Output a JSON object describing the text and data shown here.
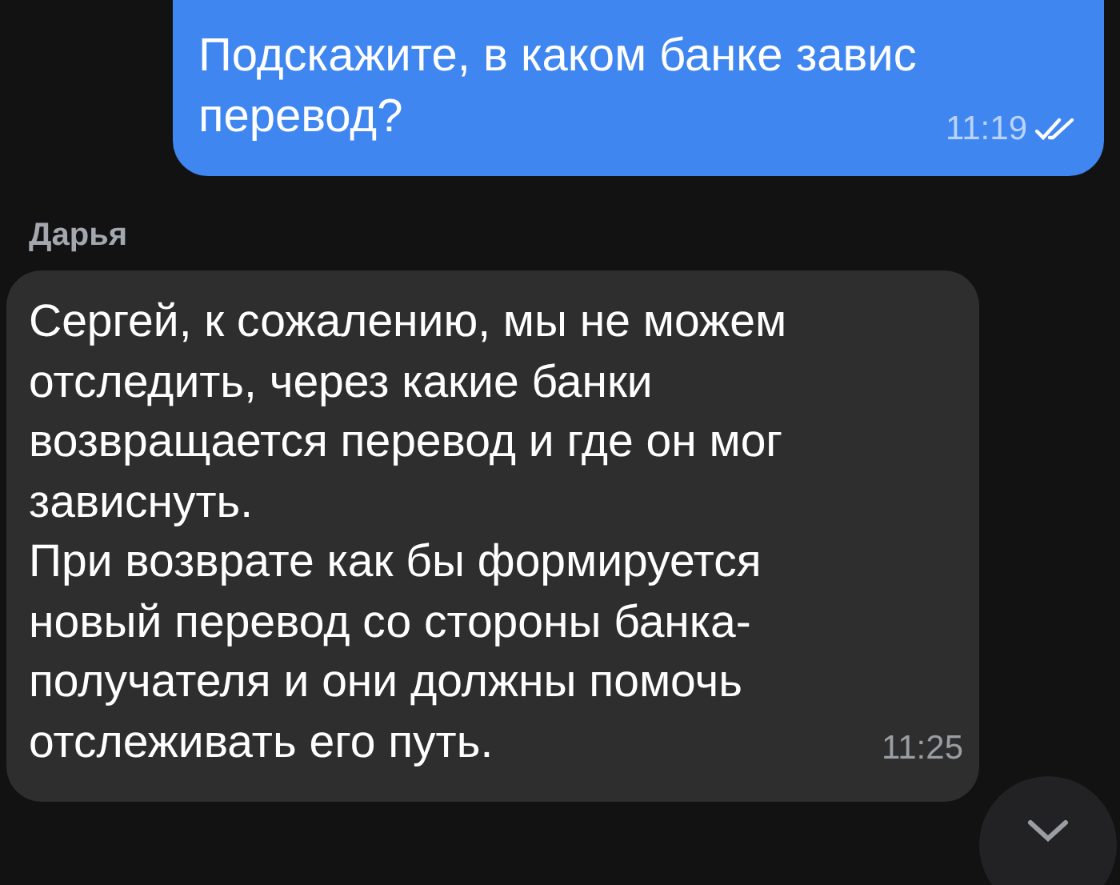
{
  "messages": [
    {
      "kind": "outgoing",
      "text": "Подскажите, в каком банке завис перевод?",
      "time": "11:19",
      "read": true
    },
    {
      "kind": "incoming",
      "sender": "Дарья",
      "paragraphs": [
        "Сергей, к сожалению, мы не можем отследить, через какие банки возвращается перевод и где он мог зависнуть.",
        "При возврате как бы формируется новый перевод со стороны банка-получателя и они должны помочь отслеживать его путь."
      ],
      "time": "11:25"
    }
  ]
}
